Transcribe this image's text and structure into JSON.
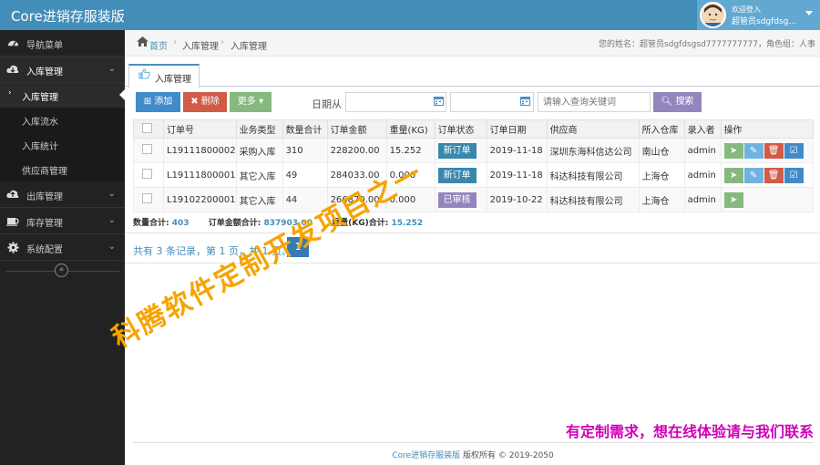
{
  "app": {
    "title": "Core进销存服装版"
  },
  "user": {
    "welcome": "欢迎登入",
    "name": "超管员sdgfdsg..."
  },
  "sidebar": {
    "nav_label": "导航菜单",
    "groups": [
      {
        "label": "入库管理",
        "icon": "cloud-download-icon"
      },
      {
        "label": "出库管理",
        "icon": "cloud-upload-icon"
      },
      {
        "label": "库存管理",
        "icon": "coffee-icon"
      },
      {
        "label": "系统配置",
        "icon": "gear-icon"
      }
    ],
    "sub_items": [
      "入库管理",
      "入库流水",
      "入库统计",
      "供应商管理"
    ]
  },
  "breadcrumb": {
    "home": "首页",
    "level1": "入库管理",
    "level2": "入库管理",
    "user_info": "您的姓名：超管员sdgfdsgsd7777777777，角色组：人事"
  },
  "tab": {
    "label": "入库管理"
  },
  "toolbar": {
    "add": "添加",
    "delete": "删除",
    "more": "更多",
    "date_label": "日期从",
    "keyword_placeholder": "请输入查询关键词",
    "search": "搜索"
  },
  "table": {
    "headers": [
      "订单号",
      "业务类型",
      "数量合计",
      "订单金额",
      "重量(KG)",
      "订单状态",
      "订单日期",
      "供应商",
      "所入仓库",
      "录入者",
      "操作"
    ],
    "rows": [
      {
        "order_no": "L19111800002",
        "type": "采购入库",
        "qty": "310",
        "amount": "228200.00",
        "weight": "15.252",
        "status": "新订单",
        "date": "2019-11-18",
        "supplier": "深圳东海科信达公司",
        "warehouse": "南山仓",
        "operator": "admin"
      },
      {
        "order_no": "L19111800001",
        "type": "其它入库",
        "qty": "49",
        "amount": "284033.00",
        "weight": "0.000",
        "status": "新订单",
        "date": "2019-11-18",
        "supplier": "科达科技有限公司",
        "warehouse": "上海仓",
        "operator": "admin"
      },
      {
        "order_no": "L19102200001",
        "type": "其它入库",
        "qty": "44",
        "amount": "266870.00",
        "weight": "0.000",
        "status": "已审核",
        "date": "2019-10-22",
        "supplier": "科达科技有限公司",
        "warehouse": "上海仓",
        "operator": "admin"
      }
    ]
  },
  "totals": {
    "qty_label": "数量合计:",
    "qty_value": "403",
    "amount_label": "订单金额合计:",
    "amount_value": "837903.00",
    "weight_label": "重量(KG)合计:",
    "weight_value": "15.252"
  },
  "pager": {
    "info": "共有 3 条记录，第 1 页，共 1 页。",
    "current": "1"
  },
  "footer": {
    "brand": "Core进销存服装版",
    "copyright": "版权所有 © 2019-2050"
  },
  "watermark": {
    "diagonal": "科腾软件定制开发项目之一",
    "bottom": "有定制需求，想在线体验请与我们联系"
  },
  "colors": {
    "topbar": "#438eb9",
    "sidebar": "#222222",
    "add": "#428bca",
    "delete": "#d15b47",
    "more": "#87b87f",
    "search": "#9585bf",
    "watermark_orange": "#f6a400",
    "watermark_magenta": "#d000b8"
  }
}
